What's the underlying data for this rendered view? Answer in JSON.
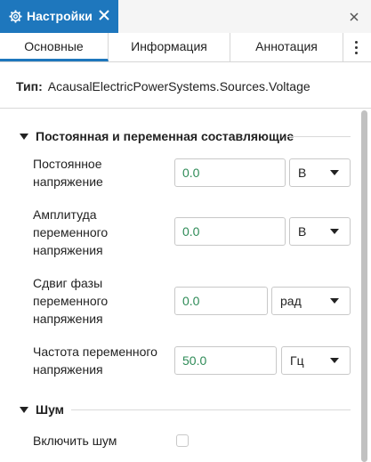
{
  "window": {
    "tab_title": "Настройки",
    "icons": {
      "settings": "gear-icon",
      "tab_close": "close-icon",
      "window_close": "close-icon",
      "more": "kebab-menu-icon"
    }
  },
  "subtabs": [
    {
      "label": "Основные",
      "active": true
    },
    {
      "label": "Информация",
      "active": false
    },
    {
      "label": "Аннотация",
      "active": false
    }
  ],
  "type_row": {
    "label": "Тип:",
    "value": "AcausalElectricPowerSystems.Sources.Voltage"
  },
  "sections": {
    "dc_ac": {
      "title": "Постоянная и переменная составляющие",
      "params": [
        {
          "label_lines": [
            "Постоянное",
            "напряжение"
          ],
          "value": "0.0",
          "unit": "В"
        },
        {
          "label_lines": [
            "Амплитуда",
            "переменного",
            "напряжения"
          ],
          "value": "0.0",
          "unit": "В"
        },
        {
          "label_lines": [
            "Сдвиг фазы",
            "переменного",
            "напряжения"
          ],
          "value": "0.0",
          "unit": "рад"
        },
        {
          "label_lines": [
            "Частота переменного",
            "напряжения"
          ],
          "value": "50.0",
          "unit": "Гц"
        }
      ]
    },
    "noise": {
      "title": "Шум",
      "enable_label": "Включить шум",
      "enabled": false
    }
  },
  "colors": {
    "accent": "#1e77bd",
    "value_text": "#2e8b57"
  }
}
